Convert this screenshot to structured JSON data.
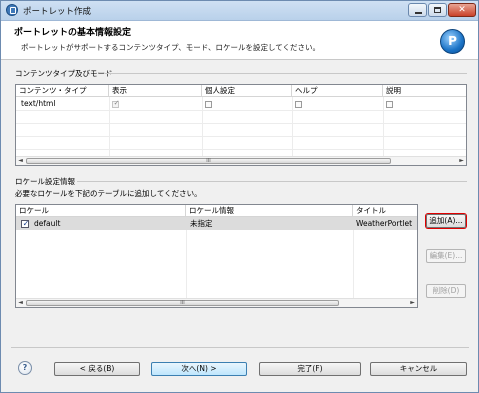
{
  "window": {
    "title": "ポートレット作成",
    "controls": {
      "minimize": "",
      "maximize": "",
      "close": "✕"
    }
  },
  "header": {
    "title": "ポートレットの基本情報設定",
    "description": "ポートレットがサポートするコンテンツタイプ、モード、ロケールを設定してください。",
    "icon": "portlet-wizard-icon",
    "icon_glyph": "P"
  },
  "content_section": {
    "label": "コンテンツタイプ及びモード",
    "columns": [
      "コンテンツ・タイプ",
      "表示",
      "個人設定",
      "ヘルプ",
      "説明"
    ],
    "rows": [
      {
        "type": "text/html",
        "view": true,
        "edit": false,
        "help": false,
        "about": false
      }
    ]
  },
  "locale_section": {
    "label": "ロケール設定情報",
    "instruction": "必要なロケールを下記のテーブルに追加してください。",
    "columns": [
      "ロケール",
      "ロケール情報",
      "タイトル"
    ],
    "rows": [
      {
        "checked": true,
        "locale": "default",
        "info": "未指定",
        "title": "WeatherPortlet"
      }
    ],
    "buttons": {
      "add": "追加(A)...",
      "edit": "編集(E)...",
      "delete": "削除(D)"
    }
  },
  "scroll": {
    "grip": "III",
    "left": "◄",
    "right": "►"
  },
  "footer": {
    "help_glyph": "?",
    "back": "< 戻る(B)",
    "next": "次へ(N) >",
    "finish": "完了(F)",
    "cancel": "キャンセル"
  },
  "colors": {
    "accent_border": "#e00000",
    "selection": "#dcdcdc",
    "title_bar": "#b9d1ea"
  }
}
